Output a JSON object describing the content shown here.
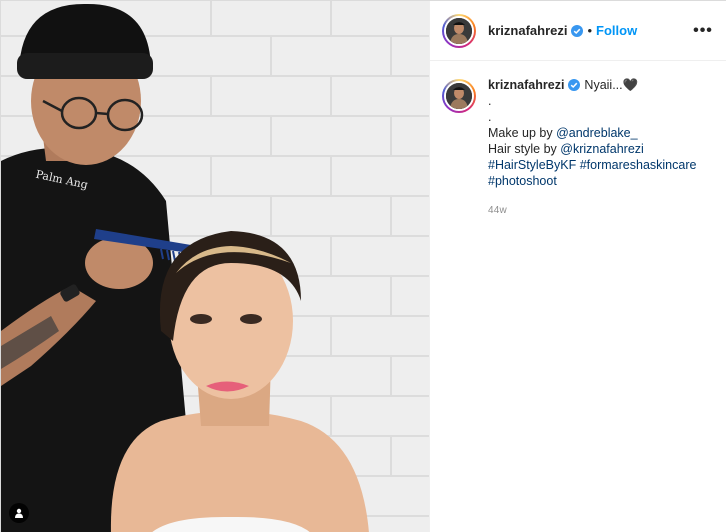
{
  "post": {
    "username": "kriznafahrezi",
    "follow_label": "Follow",
    "separator": "•",
    "more_label": "•••",
    "caption": {
      "intro_text": "Nyaii...",
      "heart": "🖤",
      "line_dot_1": ".",
      "line_dot_2": ".",
      "makeup_prefix": "Make up by ",
      "makeup_mention": "@andreblake_",
      "hair_prefix": "Hair style by ",
      "hair_mention": "@kriznafahrezi",
      "hashtag_1": "#HairStyleByKF",
      "hashtag_2": "#formareshaskincare",
      "hashtag_3": "#photoshoot"
    },
    "time_ago": "44w"
  },
  "icons": {
    "verified": "verified-badge-icon",
    "tag": "user-tag-icon",
    "more": "more-options-icon"
  },
  "colors": {
    "accent_blue": "#0095f6",
    "link_blue": "#00376b",
    "verified_blue": "#3897f0",
    "muted_gray": "#8e8e8e"
  }
}
